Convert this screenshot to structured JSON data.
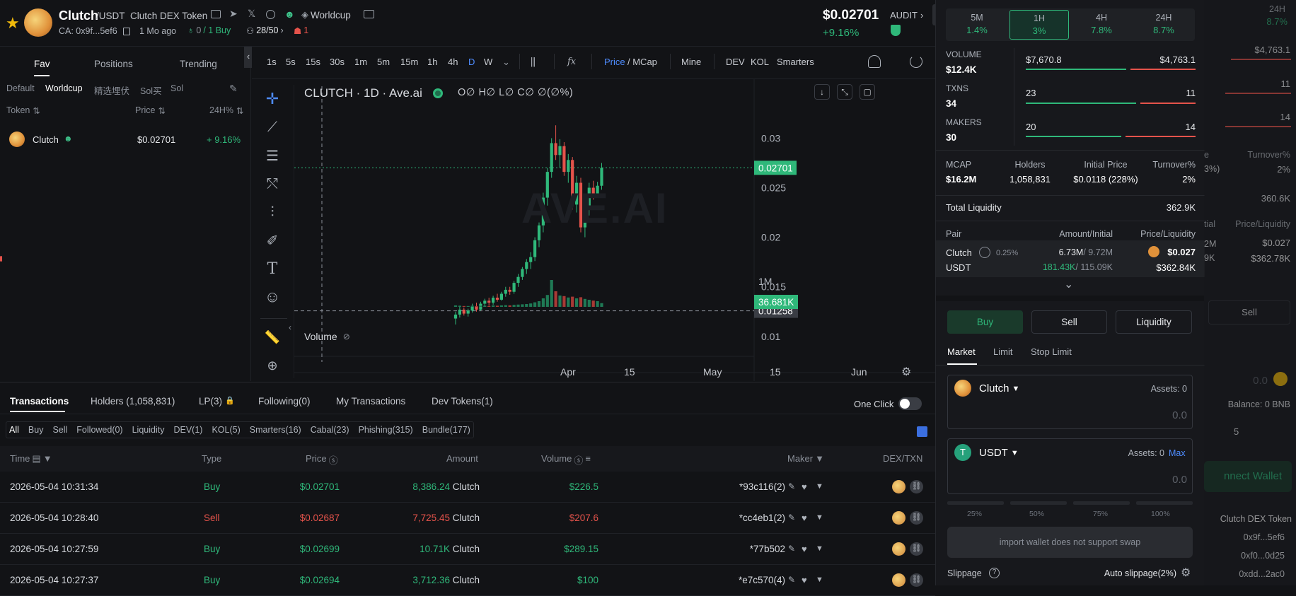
{
  "header": {
    "token_name": "Clutch",
    "pair_suffix": "/USDT",
    "full_name": "Clutch DEX Token",
    "worldcup": "Worldcup",
    "ca": "CA: 0x9f...5ef6",
    "age": "1 Mo ago",
    "buy_count_a": "0",
    "buy_count_b": "/ 1 Buy",
    "holders_ratio": "28/50",
    "flag_count": "1",
    "price": "$0.02701",
    "change": "+9.16%",
    "audit": "AUDIT"
  },
  "left": {
    "tabs": [
      "Fav",
      "Positions",
      "Trending"
    ],
    "subtabs": [
      "Default",
      "Worldcup",
      "精选埋伏",
      "Sol买",
      "Sol"
    ],
    "col_token": "Token",
    "col_price": "Price",
    "col_change": "24H%",
    "row": {
      "name": "Clutch",
      "price": "$0.02701",
      "change": "+ 9.16%"
    }
  },
  "chart_toolbar": {
    "timeframes": [
      "1s",
      "5s",
      "15s",
      "30s",
      "1m",
      "5m",
      "15m",
      "1h",
      "4h",
      "D",
      "W"
    ],
    "active_tf": "D",
    "price_label": "Price",
    "mcap_label": "/ MCap",
    "mine": "Mine",
    "dev": "DEV",
    "kol": "KOL",
    "smarters": "Smarters"
  },
  "chart_data": {
    "type": "candlestick",
    "title": "CLUTCH · 1D · Ave.ai",
    "ohlc_label": "O∅ H∅ L∅ C∅ ∅(∅%)",
    "watermark": "AVE.AI",
    "y_ticks": [
      "0.03",
      "0.025",
      "0.02",
      "0.015",
      "0.01"
    ],
    "y_range": [
      0.0092,
      0.0331
    ],
    "x_ticks": [
      "Apr",
      "15",
      "May",
      "15",
      "Jun"
    ],
    "last_price_label": "0.02701",
    "last_price": 0.02701,
    "crosshair_label": "0.01258",
    "crosshair_price": 0.01258,
    "volume_label": "Volume",
    "volume_axis": "1M",
    "volume_last": "36.681K",
    "candles": [
      [
        0.0118,
        0.0125,
        0.0112,
        0.0122
      ],
      [
        0.0122,
        0.0131,
        0.0119,
        0.0127
      ],
      [
        0.0127,
        0.0129,
        0.0121,
        0.0123
      ],
      [
        0.0123,
        0.0128,
        0.012,
        0.0126
      ],
      [
        0.0126,
        0.0133,
        0.0124,
        0.013
      ],
      [
        0.013,
        0.0134,
        0.0125,
        0.0127
      ],
      [
        0.0127,
        0.0135,
        0.0126,
        0.0133
      ],
      [
        0.0133,
        0.0138,
        0.013,
        0.0136
      ],
      [
        0.0136,
        0.0139,
        0.0131,
        0.0134
      ],
      [
        0.0134,
        0.0141,
        0.0132,
        0.0139
      ],
      [
        0.0139,
        0.0143,
        0.0135,
        0.0137
      ],
      [
        0.0137,
        0.0145,
        0.0136,
        0.0143
      ],
      [
        0.0143,
        0.015,
        0.014,
        0.0147
      ],
      [
        0.0147,
        0.015,
        0.0142,
        0.0145
      ],
      [
        0.0145,
        0.0156,
        0.0143,
        0.0154
      ],
      [
        0.0154,
        0.0163,
        0.015,
        0.016
      ],
      [
        0.016,
        0.017,
        0.0157,
        0.0168
      ],
      [
        0.0168,
        0.0178,
        0.0163,
        0.0175
      ],
      [
        0.0175,
        0.0185,
        0.0168,
        0.018
      ],
      [
        0.018,
        0.02,
        0.0176,
        0.0197
      ],
      [
        0.0197,
        0.0215,
        0.019,
        0.0212
      ],
      [
        0.0212,
        0.0245,
        0.0205,
        0.024
      ],
      [
        0.024,
        0.027,
        0.0232,
        0.0266
      ],
      [
        0.0266,
        0.03,
        0.026,
        0.0295
      ],
      [
        0.0295,
        0.0313,
        0.0278,
        0.0283
      ],
      [
        0.0283,
        0.0299,
        0.027,
        0.0292
      ],
      [
        0.0292,
        0.0296,
        0.0262,
        0.0266
      ],
      [
        0.0266,
        0.0284,
        0.0255,
        0.0278
      ],
      [
        0.0278,
        0.0281,
        0.0228,
        0.0233
      ],
      [
        0.0233,
        0.0262,
        0.0225,
        0.0255
      ],
      [
        0.0255,
        0.026,
        0.0205,
        0.021
      ],
      [
        0.021,
        0.0232,
        0.02,
        0.0228
      ],
      [
        0.0228,
        0.0255,
        0.0222,
        0.025
      ],
      [
        0.025,
        0.0257,
        0.0238,
        0.0243
      ],
      [
        0.0243,
        0.0256,
        0.024,
        0.0252
      ],
      [
        0.0252,
        0.0275,
        0.0248,
        0.027
      ]
    ],
    "volumes": [
      0.05,
      0.04,
      0.03,
      0.03,
      0.04,
      0.03,
      0.04,
      0.04,
      0.03,
      0.05,
      0.04,
      0.05,
      0.06,
      0.05,
      0.07,
      0.08,
      0.09,
      0.1,
      0.12,
      0.16,
      0.2,
      0.3,
      0.42,
      0.95,
      0.55,
      0.4,
      0.38,
      0.33,
      0.36,
      0.3,
      0.34,
      0.28,
      0.25,
      0.22,
      0.2,
      0.13
    ]
  },
  "bottom": {
    "tabs": [
      "Transactions",
      "Holders (1,058,831)",
      "LP(3)",
      "Following(0)",
      "My Transactions",
      "Dev Tokens(1)"
    ],
    "one_click": "One Click",
    "filters": [
      "All",
      "Buy",
      "Sell",
      "Followed(0)",
      "Liquidity",
      "DEV(1)",
      "KOL(5)",
      "Smarters(16)",
      "Cabal(23)",
      "Phishing(315)",
      "Bundle(177)"
    ],
    "headers": {
      "time": "Time",
      "type": "Type",
      "price": "Price",
      "amount": "Amount",
      "volume": "Volume",
      "maker": "Maker",
      "dex": "DEX/TXN"
    },
    "rows": [
      {
        "time": "2026-05-04 10:31:34",
        "type": "Buy",
        "price": "$0.02701",
        "amount": "8,386.24",
        "unit": "Clutch",
        "volume": "$226.5",
        "maker": "*93c116(2)"
      },
      {
        "time": "2026-05-04 10:28:40",
        "type": "Sell",
        "price": "$0.02687",
        "amount": "7,725.45",
        "unit": "Clutch",
        "volume": "$207.6",
        "maker": "*cc4eb1(2)"
      },
      {
        "time": "2026-05-04 10:27:59",
        "type": "Buy",
        "price": "$0.02699",
        "amount": "10.71K",
        "unit": "Clutch",
        "volume": "$289.15",
        "maker": "*77b502"
      },
      {
        "time": "2026-05-04 10:27:37",
        "type": "Buy",
        "price": "$0.02694",
        "amount": "3,712.36",
        "unit": "Clutch",
        "volume": "$100",
        "maker": "*e7c570(4)"
      }
    ]
  },
  "right": {
    "periods": [
      {
        "label": "5M",
        "value": "1.4%"
      },
      {
        "label": "1H",
        "value": "3%"
      },
      {
        "label": "4H",
        "value": "7.8%"
      },
      {
        "label": "24H",
        "value": "8.7%"
      }
    ],
    "volume_label": "VOLUME",
    "volume": "$12.4K",
    "volume_buy": "$7,670.8",
    "volume_sell": "$4,763.1",
    "buy_share": 0.617,
    "txns_label": "TXNS",
    "txns": "34",
    "txns_buy": "23",
    "txns_sell": "11",
    "txns_buy_share": 0.676,
    "makers_label": "MAKERS",
    "makers": "30",
    "makers_buy": "20",
    "makers_sell": "14",
    "makers_buy_share": 0.588,
    "mcap_label": "MCAP",
    "mcap": "$16.2M",
    "holders_label": "Holders",
    "holders": "1,058,831",
    "initial_label": "Initial Price",
    "initial": "$0.0118 (228%)",
    "turnover_label": "Turnover%",
    "turnover": "2%",
    "liquidity_label": "Total Liquidity",
    "liquidity": "362.9K",
    "pair_label": "Pair",
    "amount_label": "Amount/Initial",
    "pl_label": "Price/Liquidity",
    "pair_token": "Clutch",
    "pair_fee": "0.25%",
    "pair_quote": "USDT",
    "amt_token": "6.73M",
    "amt_token_init": "/ 9.72M",
    "amt_quote": "181.43K",
    "amt_quote_init": "/ 115.09K",
    "pair_price": "$0.027",
    "pair_liq": "$362.84K",
    "buy_btn": "Buy",
    "sell_btn": "Sell",
    "liq_btn": "Liquidity",
    "order_tabs": [
      "Market",
      "Limit",
      "Stop Limit"
    ],
    "from_token": "Clutch",
    "from_assets": "Assets: 0",
    "from_value": "0.0",
    "to_token": "USDT",
    "to_assets": "Assets: 0",
    "max": "Max",
    "to_value": "0.0",
    "pcts": [
      "25%",
      "50%",
      "75%",
      "100%"
    ],
    "warning": "import wallet does not support swap",
    "slippage": "Slippage",
    "auto_slippage": "Auto slippage(2%)"
  },
  "ghost": {
    "period_value": "8.7%",
    "period_label": "24H",
    "v1": "$4,763.1",
    "v2": "11",
    "v3": "14",
    "v4": "Turnover%",
    "v5": "2%",
    "v6": "360.6K",
    "v7": "Price/Liquidity",
    "v8": "$0.027",
    "v9": "$362.78K",
    "sell": "Sell",
    "zero": "0.0",
    "balance": "Balance: 0 BNB",
    "five": "5",
    "connect": "nnect Wallet",
    "name": "Clutch DEX Token",
    "a1": "0x9f...5ef6",
    "a2": "0xf0...0d25",
    "a3": "0xdd...2ac0",
    "frag1": "e",
    "frag2": "3%)",
    "frag3": "tial",
    "frag4": "2M",
    "frag5": "9K"
  },
  "colors": {
    "green": "#2fb87a",
    "red": "#e5534b",
    "accent": "#4e8cff",
    "bg": "#121316"
  }
}
